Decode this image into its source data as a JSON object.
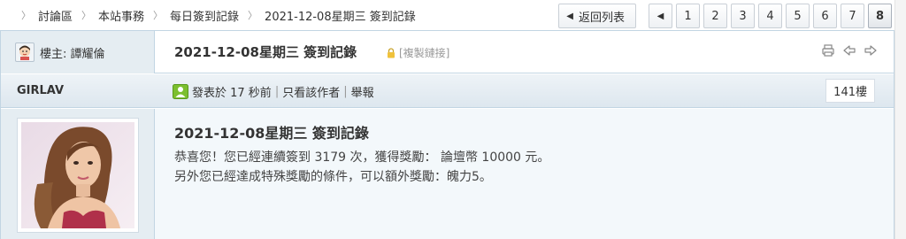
{
  "breadcrumb": [
    "討論區",
    "本站事務",
    "每日簽到記錄",
    "2021-12-08星期三 簽到記錄"
  ],
  "pager": {
    "back_label": "返回列表",
    "pages": [
      "1",
      "2",
      "3",
      "4",
      "5",
      "6",
      "7",
      "8"
    ],
    "current": "8"
  },
  "thread": {
    "op_label": "樓主: 譚耀倫",
    "title": "2021-12-08星期三 簽到記錄",
    "copy_link": "[複製鏈接]"
  },
  "post": {
    "author": "GIRLAV",
    "posted": "發表於 17 秒前",
    "only_author": "只看該作者",
    "report": "舉報",
    "floor": "141樓",
    "title": "2021-12-08星期三 簽到記錄",
    "line1": "恭喜您！您已經連續簽到 3179 次，獲得獎勵： 論壇幣 10000 元。",
    "line2": "另外您已經達成特殊獎勵的條件，可以額外獎勵：魄力5。"
  },
  "icons": {
    "breadcrumb_separator": "chevron-right-icon",
    "back": "triangle-left-icon",
    "prev": "triangle-left-icon",
    "lock": "lock-icon",
    "print": "print-icon",
    "prev_thread": "arrow-left-icon",
    "next_thread": "arrow-right-icon",
    "online": "online-status-icon"
  },
  "colors": {
    "border": "#c2d5e3",
    "author_bg": "#e5edf2",
    "body_bg": "#f3f8fb",
    "online_green": "#7cbf2f"
  }
}
